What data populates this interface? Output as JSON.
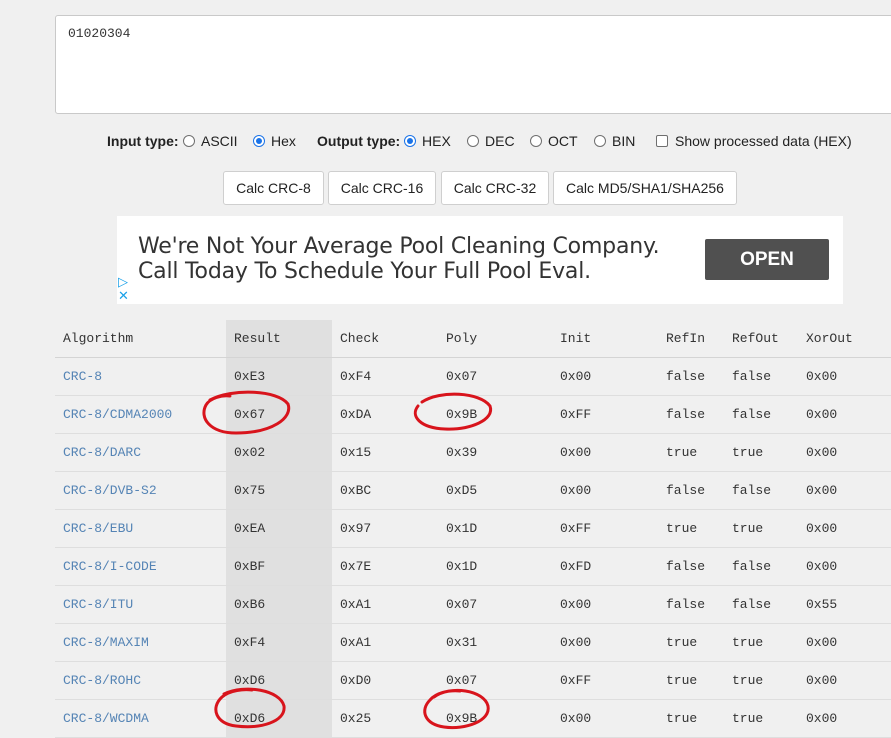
{
  "input": {
    "value": "01020304"
  },
  "options": {
    "input_type_label": "Input type:",
    "input_types": [
      {
        "label": "ASCII",
        "selected": false
      },
      {
        "label": "Hex",
        "selected": true
      }
    ],
    "output_type_label": "Output type:",
    "output_types": [
      {
        "label": "HEX",
        "selected": true
      },
      {
        "label": "DEC",
        "selected": false
      },
      {
        "label": "OCT",
        "selected": false
      },
      {
        "label": "BIN",
        "selected": false
      }
    ],
    "show_processed_label": "Show processed data (HEX)",
    "show_processed_checked": false
  },
  "buttons": [
    "Calc CRC-8",
    "Calc CRC-16",
    "Calc CRC-32",
    "Calc MD5/SHA1/SHA256"
  ],
  "ad": {
    "line1": "We're Not Your Average Pool Cleaning Company.",
    "line2": "Call Today To Schedule Your Full Pool Eval.",
    "cta": "OPEN",
    "icons": [
      "ad-choices-icon",
      "close-icon"
    ]
  },
  "table": {
    "headers": [
      "Algorithm",
      "Result",
      "Check",
      "Poly",
      "Init",
      "RefIn",
      "RefOut",
      "XorOut"
    ],
    "rows": [
      [
        "CRC-8",
        "0xE3",
        "0xF4",
        "0x07",
        "0x00",
        "false",
        "false",
        "0x00"
      ],
      [
        "CRC-8/CDMA2000",
        "0x67",
        "0xDA",
        "0x9B",
        "0xFF",
        "false",
        "false",
        "0x00"
      ],
      [
        "CRC-8/DARC",
        "0x02",
        "0x15",
        "0x39",
        "0x00",
        "true",
        "true",
        "0x00"
      ],
      [
        "CRC-8/DVB-S2",
        "0x75",
        "0xBC",
        "0xD5",
        "0x00",
        "false",
        "false",
        "0x00"
      ],
      [
        "CRC-8/EBU",
        "0xEA",
        "0x97",
        "0x1D",
        "0xFF",
        "true",
        "true",
        "0x00"
      ],
      [
        "CRC-8/I-CODE",
        "0xBF",
        "0x7E",
        "0x1D",
        "0xFD",
        "false",
        "false",
        "0x00"
      ],
      [
        "CRC-8/ITU",
        "0xB6",
        "0xA1",
        "0x07",
        "0x00",
        "false",
        "false",
        "0x55"
      ],
      [
        "CRC-8/MAXIM",
        "0xF4",
        "0xA1",
        "0x31",
        "0x00",
        "true",
        "true",
        "0x00"
      ],
      [
        "CRC-8/ROHC",
        "0xD6",
        "0xD0",
        "0x07",
        "0xFF",
        "true",
        "true",
        "0x00"
      ],
      [
        "CRC-8/WCDMA",
        "0xD6",
        "0x25",
        "0x9B",
        "0x00",
        "true",
        "true",
        "0x00"
      ]
    ]
  },
  "annotations": {
    "color": "#d8141c",
    "circled": [
      "0x67",
      "0x9B",
      "0xD6",
      "0x9B"
    ]
  },
  "colors": {
    "accent": "#1a73e8",
    "link": "#5584b5",
    "result_column": "#e0e0e0"
  }
}
